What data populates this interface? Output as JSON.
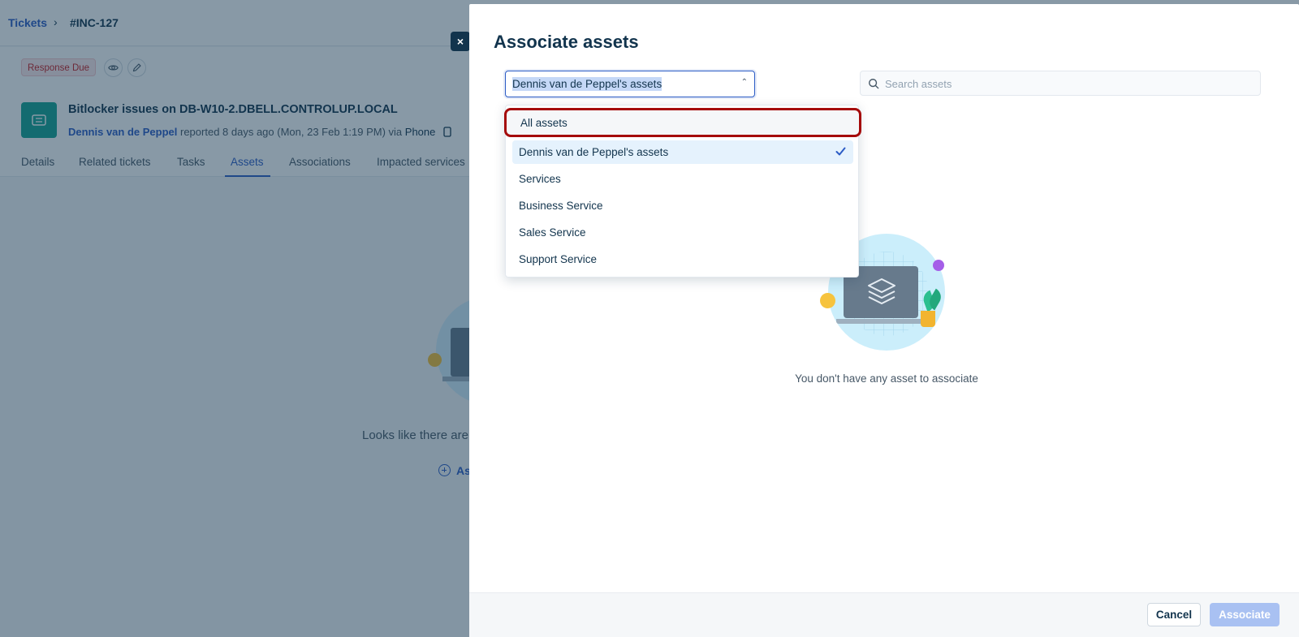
{
  "breadcrumb": {
    "root": "Tickets",
    "separator": "›",
    "current": "#INC-127"
  },
  "ticket": {
    "status_badge": "Response Due",
    "title": "Bitlocker issues on DB-W10-2.DBELL.CONTROLUP.LOCAL",
    "requester": "Dennis van de Peppel",
    "meta": "reported 8 days ago (Mon, 23 Feb 1:19 PM) via",
    "channel": "Phone"
  },
  "tabs": [
    "Details",
    "Related tickets",
    "Tasks",
    "Assets",
    "Associations",
    "Impacted services"
  ],
  "active_tab": "Assets",
  "background_empty": {
    "text": "Looks like there are",
    "add_label": "As"
  },
  "close_label": "×",
  "modal": {
    "title": "Associate assets",
    "select": {
      "value": "Dennis van de Peppel's assets",
      "caret": "⌃"
    },
    "search": {
      "placeholder": "Search assets",
      "value": ""
    },
    "dropdown_items": [
      {
        "label": "All assets"
      },
      {
        "label": "Dennis van de Peppel's assets"
      },
      {
        "label": "Services"
      },
      {
        "label": "Business Service"
      },
      {
        "label": "Sales Service"
      },
      {
        "label": "Support Service"
      }
    ],
    "highlighted_item": "All assets",
    "selected_item": "Dennis van de Peppel's assets",
    "empty_text": "You don't have any asset to associate",
    "cancel_label": "Cancel",
    "associate_label": "Associate"
  },
  "colors": {
    "accent": "#2c5cc5",
    "highlight_border": "#a50b0b",
    "selected_bg": "#e5f2fd",
    "ticket_icon": "#15a293",
    "badge_text": "#c82124"
  },
  "icons": {
    "eye": "eye-icon",
    "edit": "pencil-icon",
    "ticket": "ticket-icon",
    "search": "search-icon",
    "check": "check-icon",
    "phone": "phone-icon",
    "layers": "layers-icon"
  }
}
